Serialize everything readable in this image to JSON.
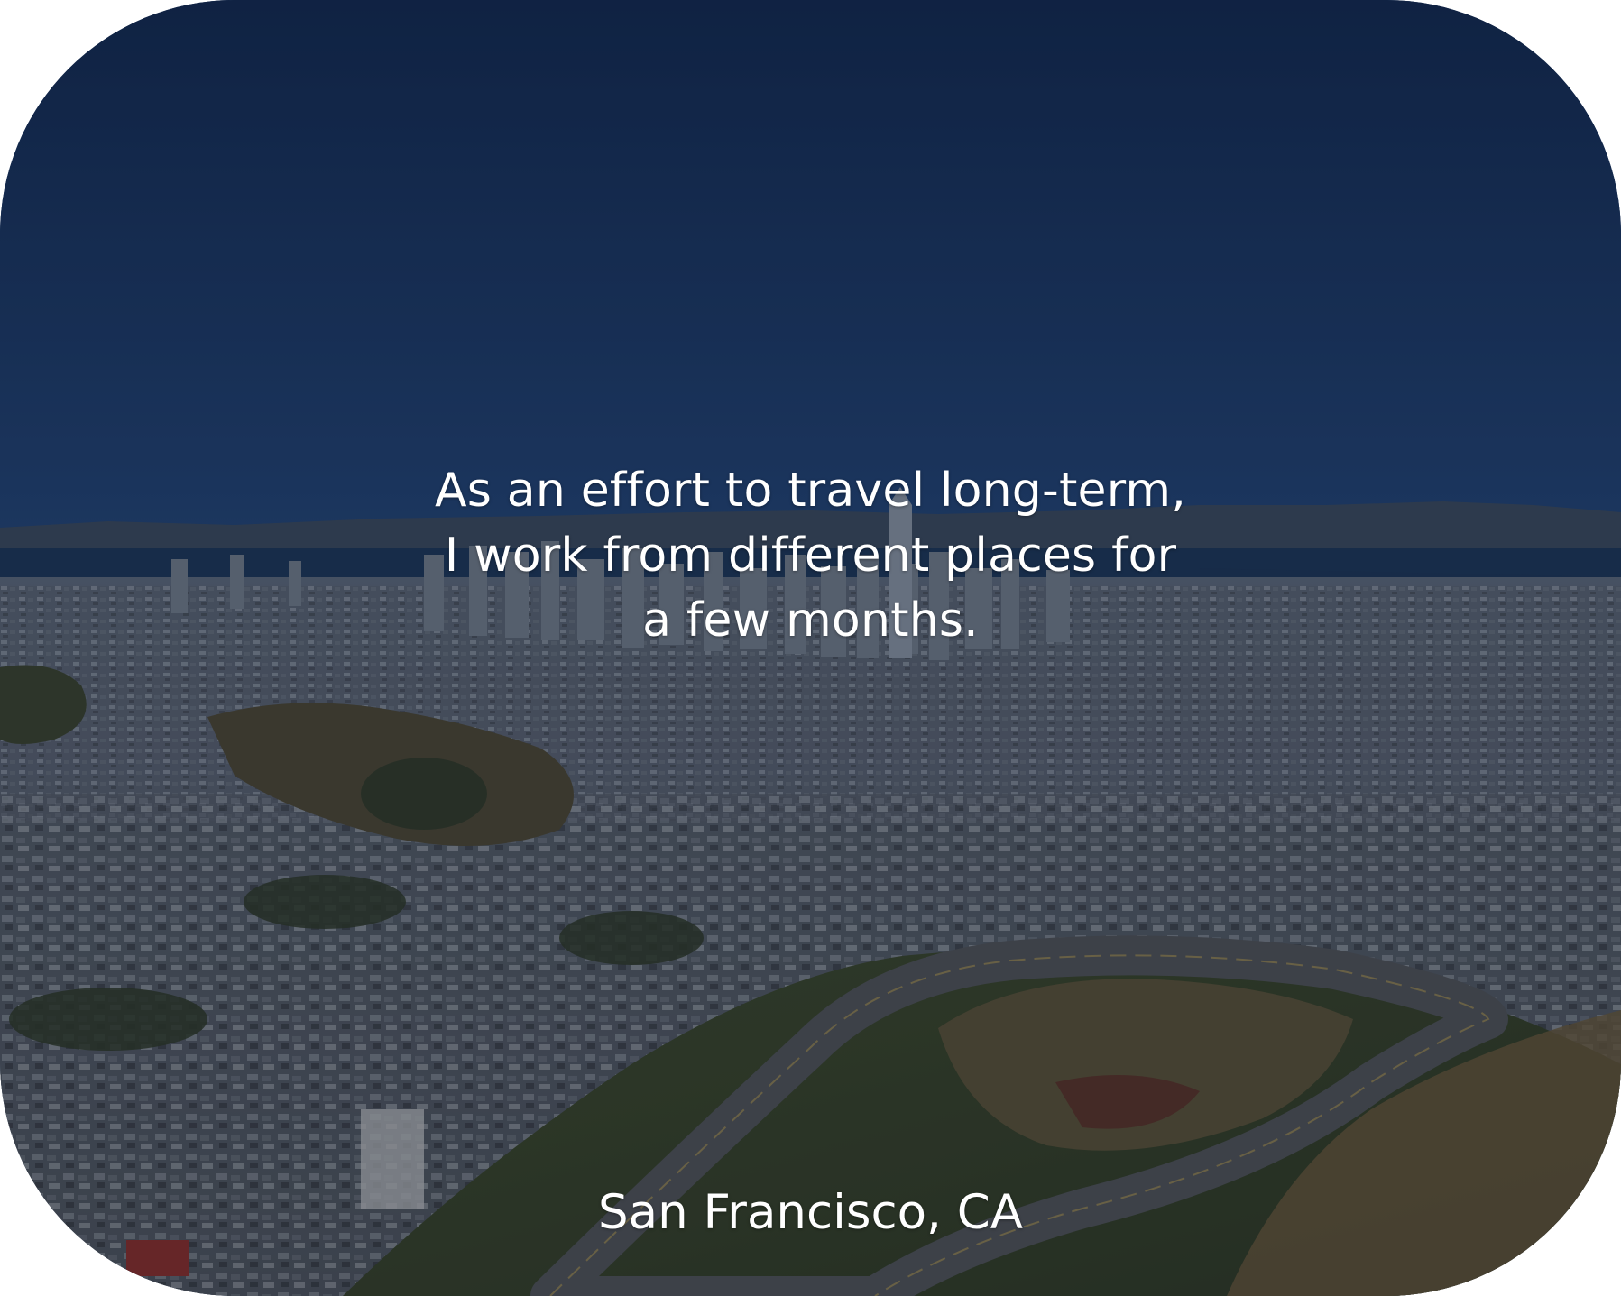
{
  "photo": {
    "subject": "",
    "colors": {
      "sky_top": "#132c55",
      "sky_bottom": "#1f4070",
      "bay": "#1b3556",
      "hills": "#3e4c5e",
      "city": "#5b6470",
      "foreground": "#3d4a2f",
      "road": "#4f5154"
    }
  },
  "caption": {
    "lines": [
      "As an effort to travel long-term,",
      "I work from different places for",
      "a few months."
    ],
    "location": "San Francisco, CA"
  }
}
